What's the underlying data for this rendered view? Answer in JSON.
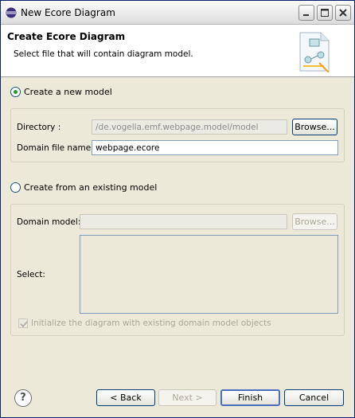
{
  "window": {
    "title": "New Ecore Diagram"
  },
  "header": {
    "title": "Create Ecore Diagram",
    "message": "Select file that will contain diagram model."
  },
  "new_model": {
    "label": "Create a new model",
    "selected": true,
    "directory_label": "Directory :",
    "directory_value": "/de.vogella.emf.webpage.model/model",
    "browse_label": "Browse...",
    "domain_file_label": "Domain file name:",
    "domain_file_value": "webpage.ecore"
  },
  "existing_model": {
    "label": "Create from an existing model",
    "selected": false,
    "domain_model_label": "Domain model:",
    "domain_model_value": "",
    "browse_label": "Browse...",
    "select_label": "Select:",
    "init_checkbox_label": "Initialize the diagram with existing domain model objects",
    "init_checked": true
  },
  "footer": {
    "help_icon": "?",
    "back_label": "< Back",
    "next_label": "Next >",
    "finish_label": "Finish",
    "cancel_label": "Cancel"
  },
  "colors": {
    "radio_selected": "#21a121",
    "button_border": "#003c74",
    "default_button_border": "#4b6fbd",
    "dialog_bg": "#ece9d8"
  }
}
